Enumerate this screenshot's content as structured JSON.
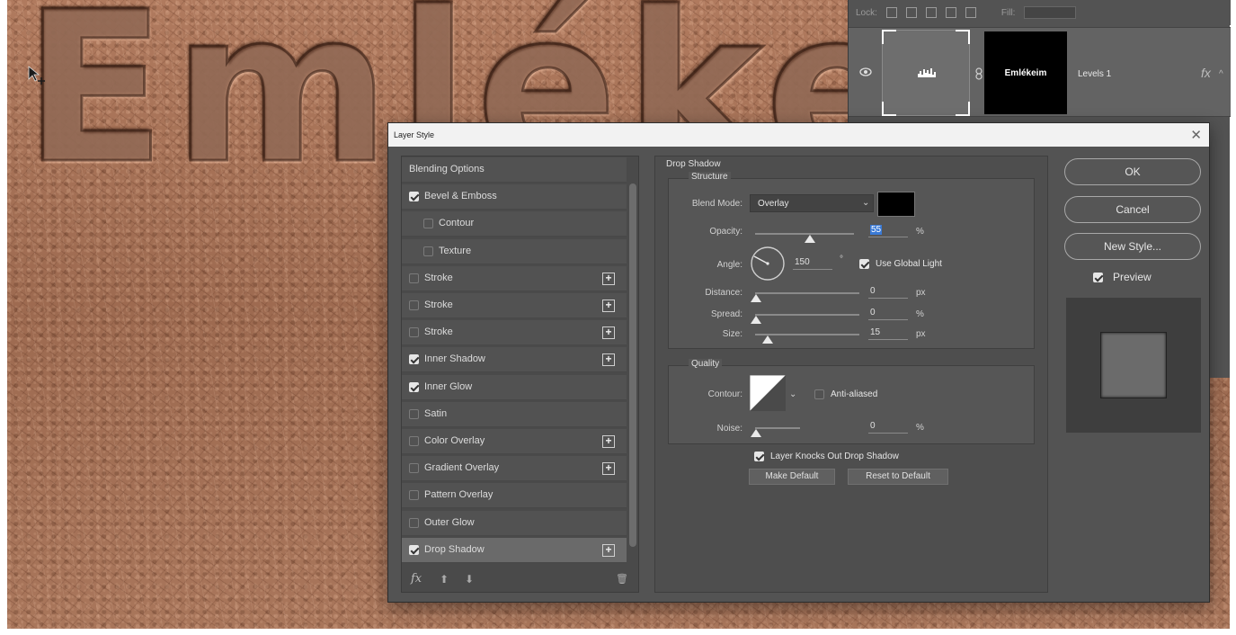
{
  "canvas": {
    "text": "Emlékez"
  },
  "layers_panel": {
    "toolbar": {
      "lock_label": "Lock:",
      "fill_label": "Fill:"
    },
    "layer": {
      "mask_text": "Emlékeim",
      "name": "Levels 1",
      "fx": "fx"
    }
  },
  "dialog": {
    "title": "Layer Style",
    "close": "✕",
    "styles": [
      {
        "label": "Blending Options",
        "checkbox": false,
        "checked": false,
        "indent": false,
        "plus": false,
        "selected": false
      },
      {
        "label": "Bevel & Emboss",
        "checkbox": true,
        "checked": true,
        "indent": false,
        "plus": false,
        "selected": false
      },
      {
        "label": "Contour",
        "checkbox": true,
        "checked": false,
        "indent": true,
        "plus": false,
        "selected": false
      },
      {
        "label": "Texture",
        "checkbox": true,
        "checked": false,
        "indent": true,
        "plus": false,
        "selected": false
      },
      {
        "label": "Stroke",
        "checkbox": true,
        "checked": false,
        "indent": false,
        "plus": true,
        "selected": false
      },
      {
        "label": "Stroke",
        "checkbox": true,
        "checked": false,
        "indent": false,
        "plus": true,
        "selected": false
      },
      {
        "label": "Stroke",
        "checkbox": true,
        "checked": false,
        "indent": false,
        "plus": true,
        "selected": false
      },
      {
        "label": "Inner Shadow",
        "checkbox": true,
        "checked": true,
        "indent": false,
        "plus": true,
        "selected": false
      },
      {
        "label": "Inner Glow",
        "checkbox": true,
        "checked": true,
        "indent": false,
        "plus": false,
        "selected": false
      },
      {
        "label": "Satin",
        "checkbox": true,
        "checked": false,
        "indent": false,
        "plus": false,
        "selected": false
      },
      {
        "label": "Color Overlay",
        "checkbox": true,
        "checked": false,
        "indent": false,
        "plus": true,
        "selected": false
      },
      {
        "label": "Gradient Overlay",
        "checkbox": true,
        "checked": false,
        "indent": false,
        "plus": true,
        "selected": false
      },
      {
        "label": "Pattern Overlay",
        "checkbox": true,
        "checked": false,
        "indent": false,
        "plus": false,
        "selected": false
      },
      {
        "label": "Outer Glow",
        "checkbox": true,
        "checked": false,
        "indent": false,
        "plus": false,
        "selected": false
      },
      {
        "label": "Drop Shadow",
        "checkbox": true,
        "checked": true,
        "indent": false,
        "plus": true,
        "selected": true
      }
    ],
    "footer": {
      "fx": "fx",
      "up": "⬆",
      "down": "⬇",
      "trash": "🗑"
    },
    "drop_shadow": {
      "section_title": "Drop Shadow",
      "structure_title": "Structure",
      "blend_mode_label": "Blend Mode:",
      "blend_mode_value": "Overlay",
      "shadow_color": "#000000",
      "opacity_label": "Opacity:",
      "opacity_value": "55",
      "opacity_unit": "%",
      "opacity_fraction": 0.55,
      "angle_label": "Angle:",
      "angle_value": "150",
      "angle_unit": "°",
      "use_global_light_label": "Use Global Light",
      "use_global_light": true,
      "distance_label": "Distance:",
      "distance_value": "0",
      "distance_unit": "px",
      "spread_label": "Spread:",
      "spread_value": "0",
      "spread_unit": "%",
      "size_label": "Size:",
      "size_value": "15",
      "size_unit": "px",
      "quality_title": "Quality",
      "contour_label": "Contour:",
      "anti_aliased_label": "Anti-aliased",
      "anti_aliased": false,
      "noise_label": "Noise:",
      "noise_value": "0",
      "noise_unit": "%",
      "layer_knocks_label": "Layer Knocks Out Drop Shadow",
      "layer_knocks": true,
      "make_default_label": "Make Default",
      "reset_default_label": "Reset to Default"
    },
    "buttons": {
      "ok": "OK",
      "cancel": "Cancel",
      "new_style": "New Style...",
      "preview_label": "Preview",
      "preview_checked": true
    }
  }
}
